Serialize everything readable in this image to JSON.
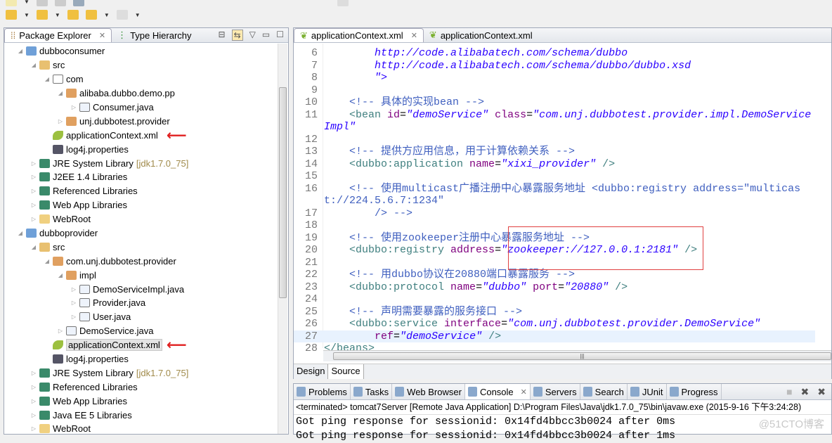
{
  "left_panel": {
    "tabs": [
      {
        "label": "Package Explorer",
        "active": true
      },
      {
        "label": "Type Hierarchy",
        "active": false
      }
    ],
    "tree": [
      {
        "label": "dubboconsumer",
        "depth": 0,
        "icon": "project-icon",
        "expanded": true
      },
      {
        "label": "src",
        "depth": 1,
        "icon": "source-folder-icon",
        "expanded": true
      },
      {
        "label": "com",
        "depth": 2,
        "icon": "empty-package-icon",
        "expanded": true
      },
      {
        "label": "alibaba.dubbo.demo.pp",
        "depth": 3,
        "icon": "package-icon",
        "expanded": true
      },
      {
        "label": "Consumer.java",
        "depth": 4,
        "icon": "java-file-icon",
        "expanded": false
      },
      {
        "label": "unj.dubbotest.provider",
        "depth": 3,
        "icon": "package-icon",
        "expanded": false
      },
      {
        "label": "applicationContext.xml",
        "depth": 2,
        "icon": "spring-xml-icon",
        "arrow": true
      },
      {
        "label": "log4j.properties",
        "depth": 2,
        "icon": "properties-file-icon"
      },
      {
        "label": "JRE System Library",
        "deco": "[jdk1.7.0_75]",
        "depth": 1,
        "icon": "library-icon",
        "expanded": false
      },
      {
        "label": "J2EE 1.4 Libraries",
        "depth": 1,
        "icon": "library-icon",
        "expanded": false
      },
      {
        "label": "Referenced Libraries",
        "depth": 1,
        "icon": "library-icon",
        "expanded": false
      },
      {
        "label": "Web App Libraries",
        "depth": 1,
        "icon": "library-icon",
        "expanded": false
      },
      {
        "label": "WebRoot",
        "depth": 1,
        "icon": "folder-icon",
        "expanded": false
      },
      {
        "label": "dubboprovider",
        "depth": 0,
        "icon": "project-error-icon",
        "expanded": true
      },
      {
        "label": "src",
        "depth": 1,
        "icon": "source-folder-icon",
        "expanded": true
      },
      {
        "label": "com.unj.dubbotest.provider",
        "depth": 2,
        "icon": "package-icon",
        "expanded": true
      },
      {
        "label": "impl",
        "depth": 3,
        "icon": "package-icon",
        "expanded": true
      },
      {
        "label": "DemoServiceImpl.java",
        "depth": 4,
        "icon": "java-file-icon",
        "expanded": false
      },
      {
        "label": "Provider.java",
        "depth": 4,
        "icon": "java-file-icon",
        "expanded": false
      },
      {
        "label": "User.java",
        "depth": 4,
        "icon": "java-file-icon",
        "expanded": false
      },
      {
        "label": "DemoService.java",
        "depth": 3,
        "icon": "java-file-icon",
        "expanded": false
      },
      {
        "label": "applicationContext.xml",
        "depth": 2,
        "icon": "spring-xml-icon",
        "selected": true,
        "arrow": true
      },
      {
        "label": "log4j.properties",
        "depth": 2,
        "icon": "properties-file-icon"
      },
      {
        "label": "JRE System Library",
        "deco": "[jdk1.7.0_75]",
        "depth": 1,
        "icon": "library-icon",
        "expanded": false
      },
      {
        "label": "Referenced Libraries",
        "depth": 1,
        "icon": "library-icon",
        "expanded": false
      },
      {
        "label": "Web App Libraries",
        "depth": 1,
        "icon": "library-icon",
        "expanded": false
      },
      {
        "label": "Java EE 5 Libraries",
        "depth": 1,
        "icon": "library-icon",
        "expanded": false
      },
      {
        "label": "WebRoot",
        "depth": 1,
        "icon": "folder-icon",
        "expanded": false
      }
    ]
  },
  "editor": {
    "tabs": [
      {
        "label": "applicationContext.xml",
        "active": true
      },
      {
        "label": "applicationContext.xml",
        "active": false
      }
    ],
    "lines": [
      {
        "n": "6",
        "seg": [
          [
            "plain",
            "        "
          ],
          [
            "val",
            "http://code.alibabatech.com/schema/dubbo"
          ]
        ]
      },
      {
        "n": "7",
        "seg": [
          [
            "plain",
            "        "
          ],
          [
            "val",
            "http://code.alibabatech.com/schema/dubbo/dubbo.xsd"
          ]
        ]
      },
      {
        "n": "8",
        "seg": [
          [
            "plain",
            "        "
          ],
          [
            "val",
            "\">"
          ]
        ]
      },
      {
        "n": "9",
        "seg": []
      },
      {
        "n": "10",
        "seg": [
          [
            "plain",
            "    "
          ],
          [
            "cmt",
            "<!-- 具体的实现bean -->"
          ]
        ]
      },
      {
        "n": "11",
        "seg": [
          [
            "plain",
            "    "
          ],
          [
            "tag",
            "<bean "
          ],
          [
            "attr",
            "id"
          ],
          [
            "plain",
            "="
          ],
          [
            "val",
            "\"demoService\""
          ],
          [
            "plain",
            " "
          ],
          [
            "attr",
            "class"
          ],
          [
            "plain",
            "="
          ],
          [
            "val",
            "\"com.unj.dubbotest.provider.impl.DemoServiceImpl\""
          ]
        ]
      },
      {
        "n": "12",
        "seg": []
      },
      {
        "n": "13",
        "seg": [
          [
            "plain",
            "    "
          ],
          [
            "cmt",
            "<!-- 提供方应用信息，用于计算依赖关系 -->"
          ]
        ]
      },
      {
        "n": "14",
        "seg": [
          [
            "plain",
            "    "
          ],
          [
            "tag",
            "<dubbo:application "
          ],
          [
            "attr",
            "name"
          ],
          [
            "plain",
            "="
          ],
          [
            "val",
            "\"xixi_provider\""
          ],
          [
            "tag",
            " />"
          ]
        ]
      },
      {
        "n": "15",
        "seg": []
      },
      {
        "n": "16",
        "seg": [
          [
            "plain",
            "    "
          ],
          [
            "cmt",
            "<!-- 使用multicast广播注册中心暴露服务地址 <dubbo:registry address=\"multicast://224.5.6.7:1234\""
          ]
        ]
      },
      {
        "n": "17",
        "seg": [
          [
            "plain",
            "        "
          ],
          [
            "cmt",
            "/> -->"
          ]
        ]
      },
      {
        "n": "18",
        "seg": []
      },
      {
        "n": "19",
        "seg": [
          [
            "plain",
            "    "
          ],
          [
            "cmt",
            "<!-- 使用zookeeper注册中心暴露服务地址 -->"
          ]
        ]
      },
      {
        "n": "20",
        "seg": [
          [
            "plain",
            "    "
          ],
          [
            "tag",
            "<dubbo:registry "
          ],
          [
            "attr",
            "address"
          ],
          [
            "plain",
            "="
          ],
          [
            "val",
            "\"zookeeper://127.0.0.1:2181\""
          ],
          [
            "tag",
            " />"
          ]
        ]
      },
      {
        "n": "21",
        "seg": []
      },
      {
        "n": "22",
        "seg": [
          [
            "plain",
            "    "
          ],
          [
            "cmt",
            "<!-- 用dubbo协议在20880端口暴露服务 -->"
          ]
        ]
      },
      {
        "n": "23",
        "seg": [
          [
            "plain",
            "    "
          ],
          [
            "tag",
            "<dubbo:protocol "
          ],
          [
            "attr",
            "name"
          ],
          [
            "plain",
            "="
          ],
          [
            "val",
            "\"dubbo\""
          ],
          [
            "plain",
            " "
          ],
          [
            "attr",
            "port"
          ],
          [
            "plain",
            "="
          ],
          [
            "val",
            "\"20880\""
          ],
          [
            "tag",
            " />"
          ]
        ]
      },
      {
        "n": "24",
        "seg": []
      },
      {
        "n": "25",
        "seg": [
          [
            "plain",
            "    "
          ],
          [
            "cmt",
            "<!-- 声明需要暴露的服务接口 -->"
          ]
        ]
      },
      {
        "n": "26",
        "seg": [
          [
            "plain",
            "    "
          ],
          [
            "tag",
            "<dubbo:service "
          ],
          [
            "attr",
            "interface"
          ],
          [
            "plain",
            "="
          ],
          [
            "val",
            "\"com.unj.dubbotest.provider.DemoService\""
          ]
        ]
      },
      {
        "n": "27",
        "current": true,
        "seg": [
          [
            "plain",
            "        "
          ],
          [
            "attr",
            "ref"
          ],
          [
            "plain",
            "="
          ],
          [
            "val",
            "\"demoService\""
          ],
          [
            "tag",
            " />"
          ]
        ]
      },
      {
        "n": "28",
        "seg": [
          [
            "tag",
            "</beans>"
          ]
        ]
      }
    ],
    "bottom_tabs": [
      {
        "label": "Design",
        "active": false
      },
      {
        "label": "Source",
        "active": true
      }
    ]
  },
  "console": {
    "tabs": [
      {
        "label": "Problems",
        "icon": "problems-icon"
      },
      {
        "label": "Tasks",
        "icon": "tasks-icon"
      },
      {
        "label": "Web Browser",
        "icon": "globe-icon"
      },
      {
        "label": "Console",
        "icon": "console-icon",
        "active": true
      },
      {
        "label": "Servers",
        "icon": "servers-icon"
      },
      {
        "label": "Search",
        "icon": "search-icon"
      },
      {
        "label": "JUnit",
        "icon": "junit-icon"
      },
      {
        "label": "Progress",
        "icon": "progress-icon"
      }
    ],
    "status": "<terminated> tomcat7Server [Remote Java Application] D:\\Program Files\\Java\\jdk1.7.0_75\\bin\\javaw.exe (2015-9-16 下午3:24:28)",
    "output": [
      "Got ping response for sessionid: 0x14fd4bbcc3b0024 after 0ms",
      "Got ping response for sessionid: 0x14fd4bbcc3b0024 after 1ms"
    ],
    "watermark": "@51CTO博客"
  },
  "colors": {
    "tag": "#3f7f7f",
    "attr": "#7f007f",
    "value": "#2a00ff",
    "comment": "#3f5fbf",
    "highlight_box": "#e04040",
    "arrow": "#e02020"
  }
}
